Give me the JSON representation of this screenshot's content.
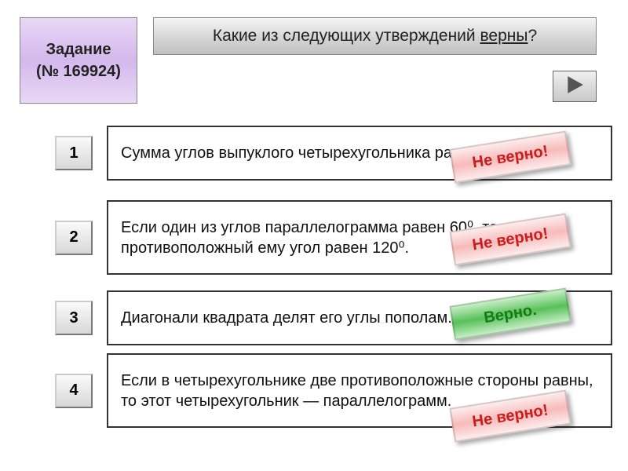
{
  "task": {
    "title": "Задание",
    "number": "(№ 169924)"
  },
  "question": {
    "prefix": "Какие из следующих утверждений ",
    "emph": "верны",
    "suffix": "?"
  },
  "options": [
    {
      "num": "1",
      "text": "Сумма углов выпуклого четырехугольника равна 180⁰.",
      "badge": "Не верно!",
      "correct": false
    },
    {
      "num": "2",
      "text": "Если один из углов параллелограмма равен 60⁰, то противоположный ему угол равен 120⁰.",
      "badge": "Не верно!",
      "correct": false
    },
    {
      "num": "3",
      "text": "Диагонали квадрата делят его углы пополам.",
      "badge": "Верно.",
      "correct": true
    },
    {
      "num": "4",
      "text": "Если в четырехугольнике две противоположные стороны равны, то этот четырехугольник — параллелограмм.",
      "badge": "Не верно!",
      "correct": false
    }
  ]
}
